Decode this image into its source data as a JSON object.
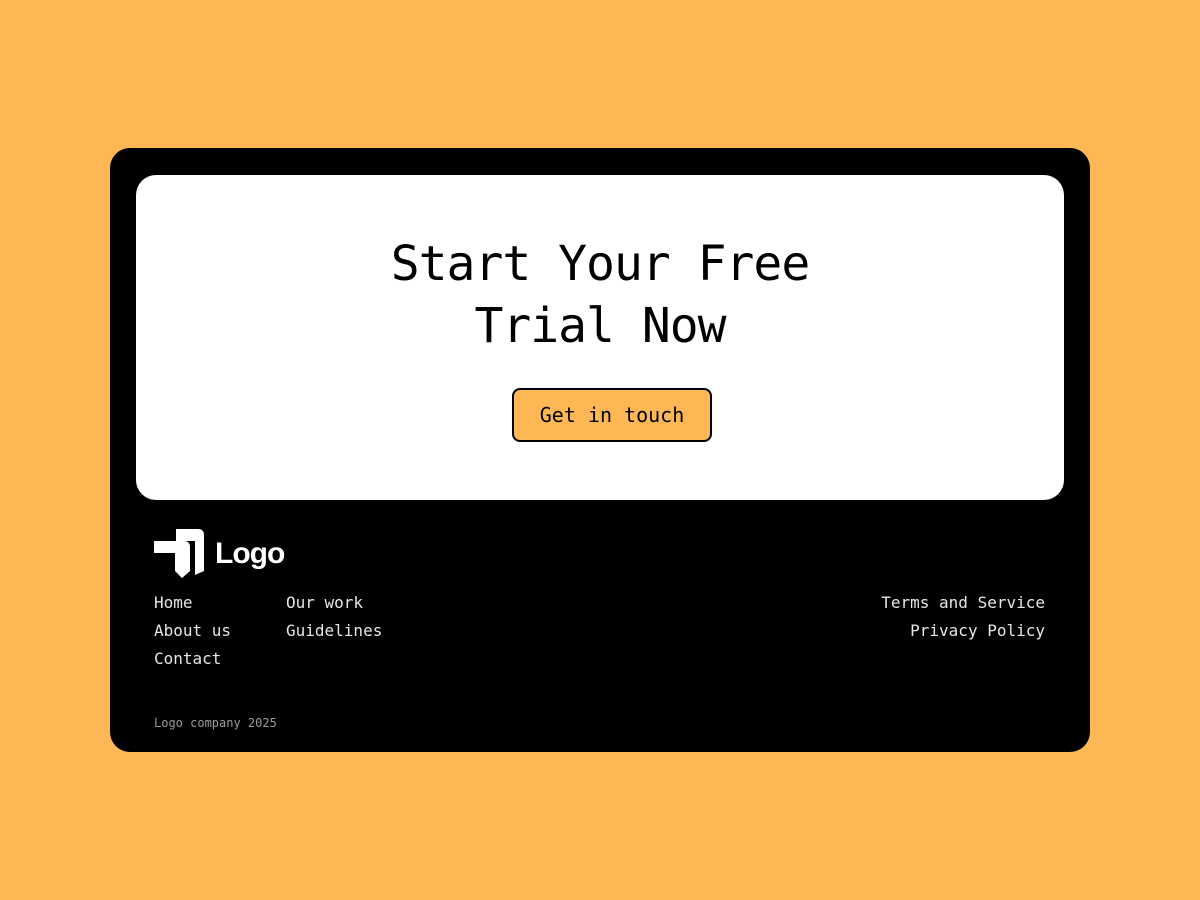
{
  "hero": {
    "title_line1": "Start Your Free",
    "title_line2": "Trial Now",
    "cta_label": "Get in touch"
  },
  "footer": {
    "logo_text": "Logo",
    "nav_col1": [
      "Home",
      "About us",
      "Contact"
    ],
    "nav_col2": [
      "Our work",
      "Guidelines"
    ],
    "legal": [
      "Terms and Service",
      "Privacy Policy"
    ],
    "copyright": "Logo company 2025"
  },
  "colors": {
    "page_background": "#FDB754",
    "card_background": "#000000",
    "hero_background": "#FFFFFF",
    "accent": "#FDB754",
    "footer_text": "#E6E6E6",
    "copyright_text": "#9A9A9A"
  },
  "icons": {
    "logo_mark": "logo-mark-icon"
  }
}
